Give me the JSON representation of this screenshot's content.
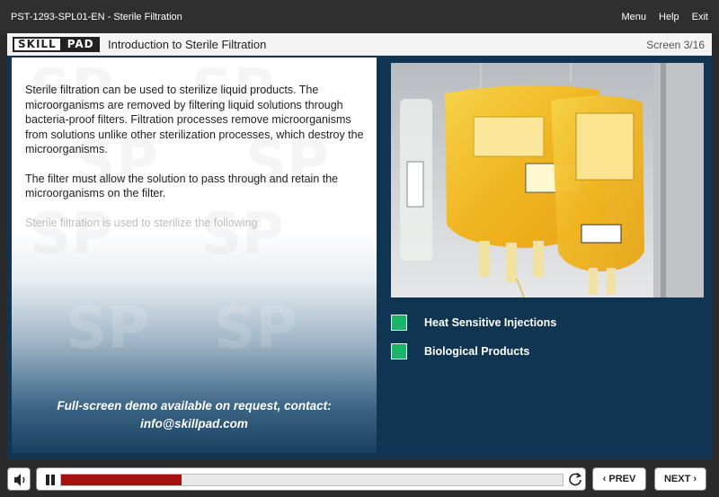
{
  "topbar": {
    "course_title": "PST-1293-SPL01-EN - Sterile Filtration",
    "menu_label": "Menu",
    "help_label": "Help",
    "exit_label": "Exit"
  },
  "header": {
    "logo_part1": "SKILL",
    "logo_part2": "PAD",
    "lesson_title": "Introduction to Sterile Filtration",
    "screen_counter": "Screen 3/16"
  },
  "left_panel": {
    "paragraph1": "Sterile filtration can be used to sterilize liquid products. The microorganisms are removed by filtering liquid solutions through bacteria-proof filters. Filtration processes remove microorganisms from solutions unlike other sterilization processes, which destroy the microorganisms.",
    "paragraph2": "The filter must allow the solution to pass through and retain the microorganisms on the filter.",
    "paragraph3": "Sterile filtration is used to sterilize the following:",
    "demo_line1": "Full-screen demo available on request, contact:",
    "demo_line2": "info@skillpad.com",
    "watermark_text": "SP"
  },
  "right_panel": {
    "bullets": [
      {
        "label": "Heat Sensitive Injections"
      },
      {
        "label": "Biological Products"
      }
    ],
    "accent_color": "#1bb56a"
  },
  "player": {
    "progress_fraction": 0.24,
    "progress_color": "#a51111",
    "prev_label": "PREV",
    "next_label": "NEXT"
  },
  "colors": {
    "panel_background": "#0f3552",
    "top_bar": "#2f2f2f"
  }
}
